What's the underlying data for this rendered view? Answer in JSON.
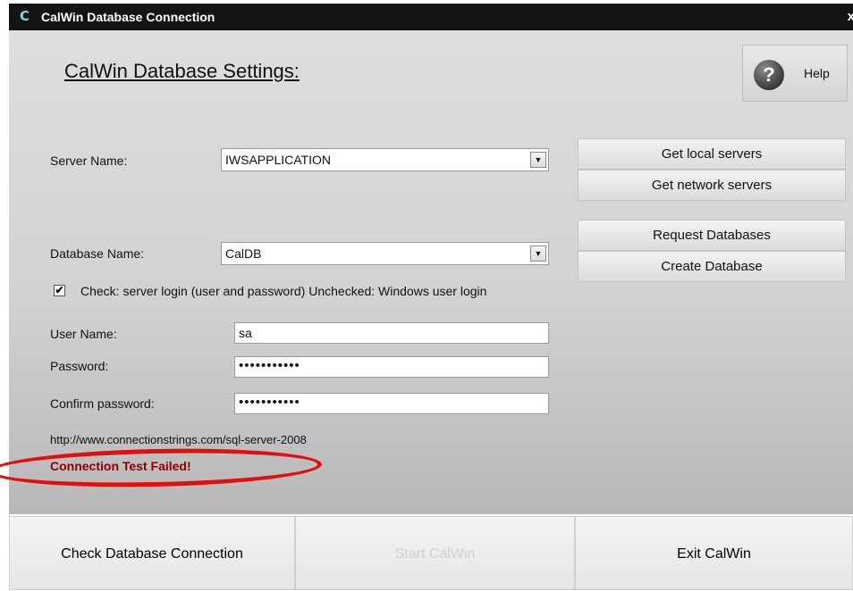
{
  "window": {
    "title": "CalWin Database Connection",
    "app_icon_glyph": "C",
    "close_glyph": "x"
  },
  "heading": "CalWin Database Settings:",
  "help": {
    "label": "Help",
    "icon_glyph": "?"
  },
  "server": {
    "label": "Server Name:",
    "value": "IWSAPPLICATION"
  },
  "server_buttons": {
    "local": "Get local servers",
    "network": "Get network servers"
  },
  "database": {
    "label": "Database Name:",
    "value": "CalDB"
  },
  "database_buttons": {
    "request": "Request Databases",
    "create": "Create Database"
  },
  "login_check": {
    "checked": true,
    "mark": "✔",
    "label": "Check: server login (user and password) Unchecked: Windows user login"
  },
  "user": {
    "label": "User Name:",
    "value": "sa"
  },
  "password": {
    "label": "Password:",
    "value": "•••••••••••"
  },
  "confirm": {
    "label": "Confirm password:",
    "value": "•••••••••••"
  },
  "link": "http://www.connectionstrings.com/sql-server-2008",
  "status": "Connection Test Failed!",
  "footer": {
    "check": "Check Database Connection",
    "start": "Start CalWin",
    "exit": "Exit CalWin"
  },
  "colors": {
    "status": "#8b0000",
    "highlight": "#e01010",
    "titlebar": "#141414"
  }
}
